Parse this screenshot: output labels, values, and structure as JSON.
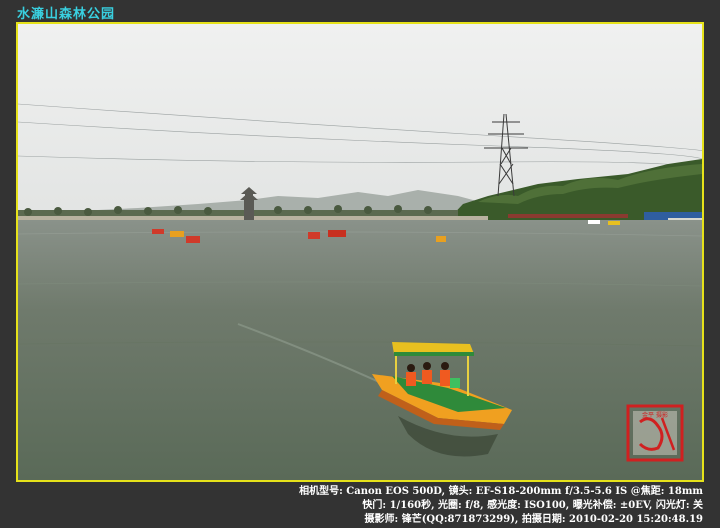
{
  "title": "水濂山森林公园",
  "photo": {
    "scene": "lake-with-pedal-boats",
    "colors": {
      "sky": "#eceeed",
      "water": "#6f7a6c",
      "frame": "#e6e21a",
      "boat_hull": "#f0a020",
      "boat_canopy": "#e8c020",
      "hill": "#3a5a2a",
      "stamp": "#d02020"
    },
    "stamp_text": "金平 摄影"
  },
  "exif": {
    "line1": "相机型号: Canon EOS 500D, 镜头: EF-S18-200mm f/3.5-5.6 IS @焦距: 18mm",
    "line2": "快门: 1/160秒, 光圈: f/8, 感光度: ISO100, 曝光补偿: ±0EV, 闪光灯: 关",
    "line3": "摄影师: 锋芒(QQ:871873299), 拍摄日期: 2010-02-20 15:20:48.19"
  }
}
